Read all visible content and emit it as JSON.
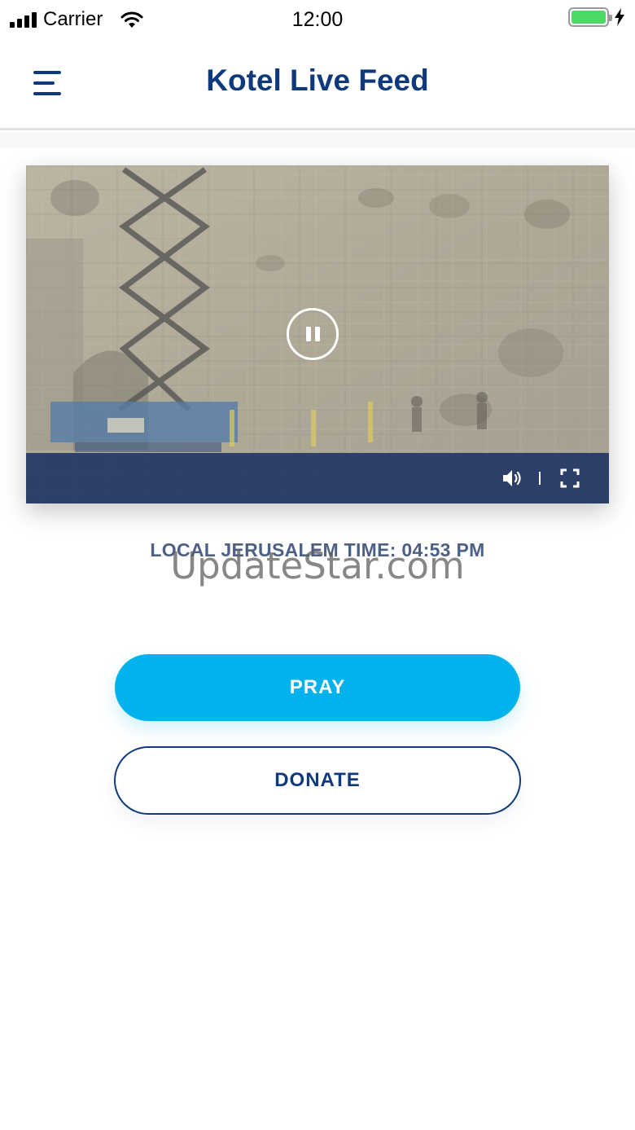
{
  "status_bar": {
    "carrier": "Carrier",
    "time": "12:00",
    "signal_icon": "signal-bars-icon",
    "wifi_icon": "wifi-icon",
    "battery_icon": "battery-icon",
    "charging_icon": "lightning-bolt-icon",
    "battery_level": 1.0,
    "battery_color": "#4cd964"
  },
  "header": {
    "title": "Kotel Live Feed",
    "menu_icon": "hamburger-menu-icon"
  },
  "video": {
    "pause_icon": "pause-icon",
    "volume_icon": "volume-icon",
    "fullscreen_icon": "fullscreen-icon",
    "controls_color": "#162c60"
  },
  "main": {
    "local_time": "LOCAL JERUSALEM TIME: 04:53 PM",
    "watermark": "UpdateStar.com",
    "pray_label": "PRAY",
    "donate_label": "DONATE"
  },
  "colors": {
    "brand_navy": "#0e3a7d",
    "accent_blue": "#02b2ec",
    "time_text": "#4d6186"
  }
}
